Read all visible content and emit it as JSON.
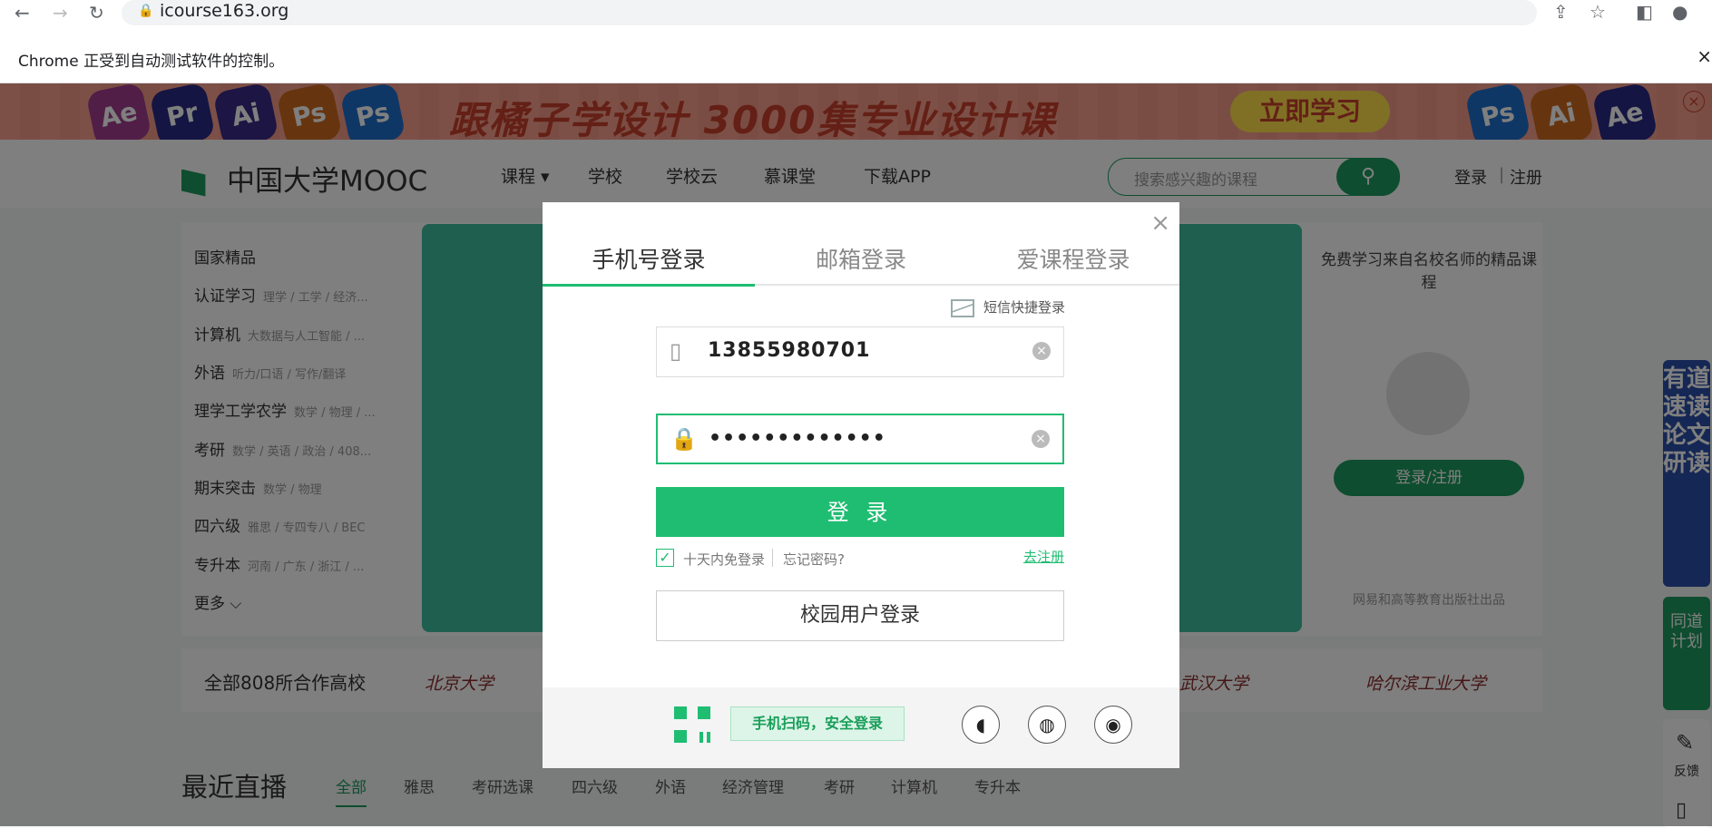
{
  "browser": {
    "url": "icourse163.org",
    "infobar_text": "Chrome 正受到自动测试软件的控制。",
    "infobar_close": "×"
  },
  "banner": {
    "slogan": "跟橘子学设计 3000集专业设计课",
    "cta": "立即学习",
    "apps": [
      "Ae",
      "Pr",
      "Ai",
      "Ps",
      "Ps",
      "Ai",
      "Ae"
    ],
    "close": "×"
  },
  "header": {
    "logo": "中国大学MOOC",
    "nav": [
      "课程",
      "学校",
      "学校云",
      "慕课堂",
      "下载APP"
    ],
    "search_placeholder": "搜索感兴趣的课程",
    "login": "登录",
    "divider": "|",
    "register": "注册"
  },
  "categories": [
    {
      "name": "国家精品",
      "sub": ""
    },
    {
      "name": "认证学习",
      "sub": "理学 / 工学 / 经济..."
    },
    {
      "name": "计算机",
      "sub": "大数据与人工智能 / ..."
    },
    {
      "name": "外语",
      "sub": "听力/口语 / 写作/翻译"
    },
    {
      "name": "理学工学农学",
      "sub": "数学 / 物理 / ..."
    },
    {
      "name": "考研",
      "sub": "数学 / 英语 / 政治 / 408..."
    },
    {
      "name": "期末突击",
      "sub": "数学 / 物理"
    },
    {
      "name": "四六级",
      "sub": "雅思 / 专四专八 / BEC"
    },
    {
      "name": "专升本",
      "sub": "河南 / 广东 / 浙江 / ..."
    },
    {
      "name": "更多 ⌵",
      "sub": ""
    }
  ],
  "sidecard": {
    "title": "免费学习来自名校名师的精品课程",
    "button": "登录/注册",
    "footer": "网易和高等教育出版社出品"
  },
  "schools": {
    "all": "全部808所合作高校",
    "logos": [
      "北京大学",
      "武汉大学",
      "哈尔滨工业大学"
    ]
  },
  "live": {
    "title": "最近直播",
    "tabs": [
      "全部",
      "雅思",
      "考研选课",
      "四六级",
      "外语",
      "经济管理",
      "考研",
      "计算机",
      "专升本"
    ]
  },
  "side_ads": {
    "youdao": "有道速读论文研读",
    "tongdao": "同道计划",
    "feedback": "反馈"
  },
  "modal": {
    "close": "×",
    "tabs": [
      "手机号登录",
      "邮箱登录",
      "爱课程登录"
    ],
    "active_tab": "手机号登录",
    "sms_login": "短信快捷登录",
    "phone_value": "13855980701",
    "password_value": "•••••••••••••",
    "login_button": "登 录",
    "remember": "十天内免登录",
    "remember_checked": true,
    "forgot": "忘记密码?",
    "register": "去注册",
    "campus_login": "校园用户登录",
    "qr_tip": "手机扫码，安全登录",
    "social": [
      "qq-icon",
      "wechat-icon",
      "weibo-icon"
    ],
    "accent_color": "#1fbd72"
  }
}
